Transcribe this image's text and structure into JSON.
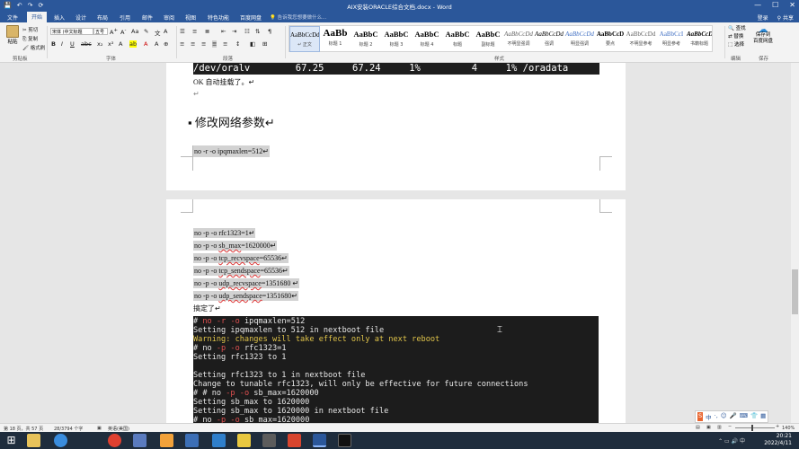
{
  "window": {
    "title": "AIX安装ORACLE综合文档.docx - Word",
    "quick_access": [
      "💾",
      "↶",
      "↷",
      "⟳"
    ],
    "controls": [
      "—",
      "☐",
      "✕"
    ]
  },
  "tabs": {
    "items": [
      "文件",
      "开始",
      "插入",
      "设计",
      "布局",
      "引用",
      "邮件",
      "审阅",
      "视图",
      "特色功能",
      "百度网盘"
    ],
    "search_placeholder": "告诉我您想要做什么...",
    "login": "登录",
    "share": "共享"
  },
  "ribbon": {
    "clipboard": {
      "paste": "粘贴",
      "cut": "剪切",
      "copy": "复制",
      "format_painter": "格式刷",
      "label": "剪贴板"
    },
    "font": {
      "font_name": "宋体 (中文标题",
      "font_size": "五号",
      "label": "字体"
    },
    "paragraph": {
      "label": "段落"
    },
    "styles": {
      "label": "样式",
      "items": [
        {
          "preview": "AaBbCcDd",
          "name": "↵ 正文"
        },
        {
          "preview": "AaBb",
          "name": "标题 1"
        },
        {
          "preview": "AaBbC",
          "name": "标题 2"
        },
        {
          "preview": "AaBbC",
          "name": "标题 3"
        },
        {
          "preview": "AaBbC",
          "name": "标题 4"
        },
        {
          "preview": "AaBbC",
          "name": "标题"
        },
        {
          "preview": "AaBbC",
          "name": "副标题"
        },
        {
          "preview": "AaBbCcDd",
          "name": "不明显强调"
        },
        {
          "preview": "AaBbCcDd",
          "name": "强调"
        },
        {
          "preview": "AaBbCcDd",
          "name": "明显强调"
        },
        {
          "preview": "AaBbCcD",
          "name": "要点"
        },
        {
          "preview": "AaBbCcDd",
          "name": "不明显参考"
        },
        {
          "preview": "AaBbCcI",
          "name": "明显参考"
        },
        {
          "preview": "AaBbCcD",
          "name": "书籍标题"
        }
      ]
    },
    "editing": {
      "find": "查找",
      "replace": "替换",
      "select": "选择",
      "label": "编辑"
    },
    "save": {
      "line1": "保存到",
      "line2": "百度网盘",
      "label": "保存"
    }
  },
  "document": {
    "page1": {
      "banner": "/dev/oralv        67.25     67.24     1%         4     1% /oradata",
      "line1": "OK 自动挂载了。↵",
      "line2": "↵",
      "heading": "修改网络参数↵",
      "cmd": "no -r -o ipqmaxlen=512↵"
    },
    "page2": {
      "lines": [
        {
          "pre": "no -p -o rfc1323=1↵",
          "ul": "",
          "post": ""
        },
        {
          "pre": "no -p -o ",
          "ul": "sb_max",
          "post": "=1620000↵"
        },
        {
          "pre": "no -p -o ",
          "ul": "tcp_recvspace",
          "post": "=65536↵"
        },
        {
          "pre": "no -p -o ",
          "ul": "tcp_sendspace",
          "post": "=65536↵"
        },
        {
          "pre": "no -p -o ",
          "ul": "udp_recvspace",
          "post": "=1351680 ↵"
        },
        {
          "pre": "no -p -o ",
          "ul": "udp_sendspace",
          "post": "=1351680↵"
        }
      ],
      "done": "搞定了↵",
      "terminal": [
        "# no -r -o ipqmaxlen=512",
        "Setting ipqmaxlen to 512 in nextboot file",
        "Warning: changes will take effect only at next reboot",
        "# no -p -o rfc1323=1",
        "Setting rfc1323 to 1",
        "",
        "Setting rfc1323 to 1 in nextboot file",
        "Change to tunable rfc1323, will only be effective for future connections",
        "# # no -p -o sb_max=1620000",
        "Setting sb_max to 1620000",
        "Setting sb_max to 1620000 in nextboot file",
        "# no -p -o sb_max=1620000"
      ]
    }
  },
  "status": {
    "page": "第 18 页，共 57 页",
    "words": "28/3794 个字",
    "lang": "英语(美国)",
    "zoom": "140%"
  },
  "taskbar": {
    "time": "20:21",
    "date": "2022/4/11"
  }
}
